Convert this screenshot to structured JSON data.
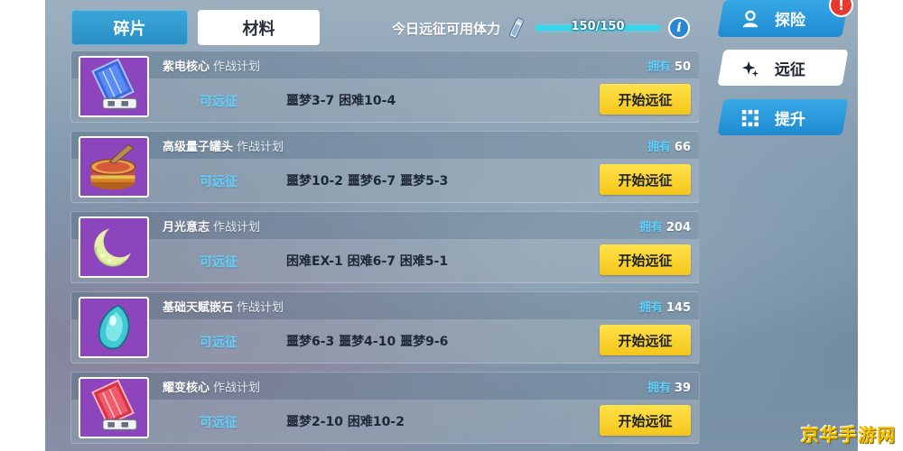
{
  "tabs": {
    "fragments": "碎片",
    "materials": "材料"
  },
  "stamina": {
    "label": "今日远征可用体力",
    "value": "150/150",
    "fill": 1.0,
    "info": "i"
  },
  "items": [
    {
      "name": "紫电核心",
      "plan": "作战计划",
      "owned_label": "拥有",
      "owned": "50",
      "status": "可远征",
      "stages": "噩梦3-7 困难10-4",
      "button": "开始远征",
      "icon": "purple-crystal-core-icon"
    },
    {
      "name": "高级量子罐头",
      "plan": "作战计划",
      "owned_label": "拥有",
      "owned": "66",
      "status": "可远征",
      "stages": "噩梦10-2 噩梦6-7 噩梦5-3",
      "button": "开始远征",
      "icon": "quantum-can-icon"
    },
    {
      "name": "月光意志",
      "plan": "作战计划",
      "owned_label": "拥有",
      "owned": "204",
      "status": "可远征",
      "stages": "困难EX-1 困难6-7 困难5-1",
      "button": "开始远征",
      "icon": "crescent-moon-icon"
    },
    {
      "name": "基础天赋嵌石",
      "plan": "作战计划",
      "owned_label": "拥有",
      "owned": "145",
      "status": "可远征",
      "stages": "噩梦6-3 噩梦4-10 噩梦9-6",
      "button": "开始远征",
      "icon": "talent-gem-icon"
    },
    {
      "name": "耀变核心",
      "plan": "作战计划",
      "owned_label": "拥有",
      "owned": "39",
      "status": "可远征",
      "stages": "噩梦2-10 困难10-2",
      "button": "开始远征",
      "icon": "red-crystal-core-icon"
    }
  ],
  "nav": {
    "explore": "探险",
    "expedition": "远征",
    "upgrade": "提升",
    "alert": "!"
  },
  "watermark": "京华手游网",
  "colors": {
    "accent_blue": "#2a8fc4",
    "button_yellow": "#f5c61a",
    "status_cyan": "#5fd0ff",
    "alert_red": "#e8392f"
  }
}
